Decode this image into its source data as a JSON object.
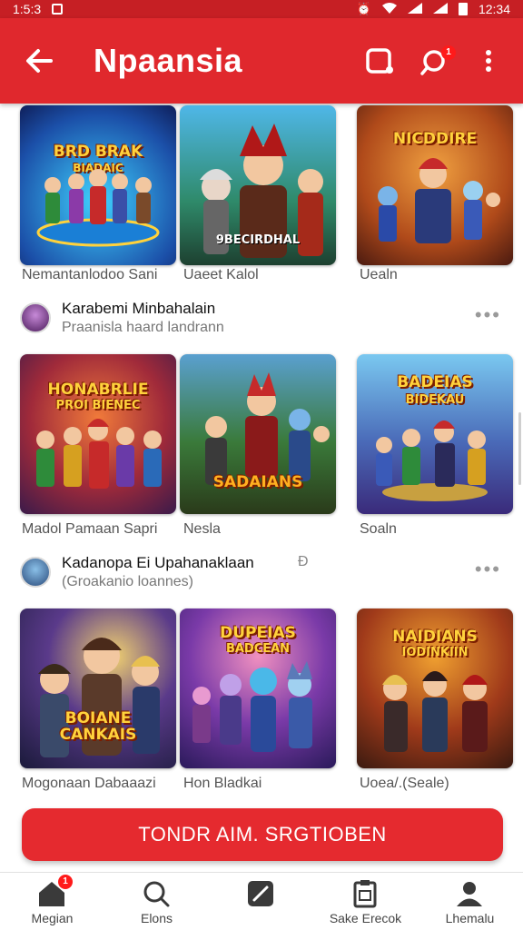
{
  "status_bar": {
    "time_left": "1:5:3",
    "time_right": "12:34"
  },
  "app_bar": {
    "title": "Npaansia",
    "notification_count": "1"
  },
  "rows": [
    {
      "cards": [
        {
          "art_title": "BRD BRAK",
          "art_subtitle": "BIADAIC",
          "caption": "Nemantanlodoo Sani"
        },
        {
          "art_title": "",
          "art_subtitle": "9BECIRDHAL",
          "caption": "Uaeet Kalol"
        },
        {
          "art_title": "NICDDIRE",
          "art_subtitle": "",
          "caption": "Uealn"
        }
      ]
    },
    {
      "section": {
        "name": "Karabemi Minbahalain",
        "subtitle": "Praanisla haard landrann"
      },
      "cards": [
        {
          "art_title": "HONABRLIE",
          "art_subtitle": "PROI BIENEC",
          "caption": "Madol Pamaan Sapri"
        },
        {
          "art_title": "SADAIANS",
          "art_subtitle": "",
          "caption": "Nesla"
        },
        {
          "art_title": "BADEIAS",
          "art_subtitle": "BIDEKAU",
          "caption": "Soaln"
        }
      ]
    },
    {
      "section": {
        "name": "Kadanopa Ei Upahanaklaan",
        "subtitle": "(Groakanio loannes)",
        "marker": "Ɖ"
      },
      "cards": [
        {
          "art_title": "BOIANE",
          "art_subtitle": "CANKAIS",
          "caption": "Mogonaan Dabaaazi"
        },
        {
          "art_title": "DUPEIAS",
          "art_subtitle": "BADCEAN",
          "caption": "Hon Bladkai"
        },
        {
          "art_title": "NAIDIANS",
          "art_subtitle": "IODINKIIN",
          "caption": "Uoea/.(Seale)"
        }
      ]
    }
  ],
  "cta_button": {
    "label": "TONDR AIM. SRGTIOBEN"
  },
  "bottom_nav": {
    "badge": "1",
    "items": [
      {
        "label": "Megian",
        "icon": "home-icon"
      },
      {
        "label": "Elons",
        "icon": "search-icon"
      },
      {
        "label": "",
        "icon": "edit-icon"
      },
      {
        "label": "Sake Erecok",
        "icon": "clipboard-icon"
      },
      {
        "label": "Lhemalu",
        "icon": "profile-icon"
      }
    ]
  },
  "colors": {
    "primary": "#e0282d",
    "status_bar": "#c61f24",
    "title_art": "#ffd23c"
  }
}
